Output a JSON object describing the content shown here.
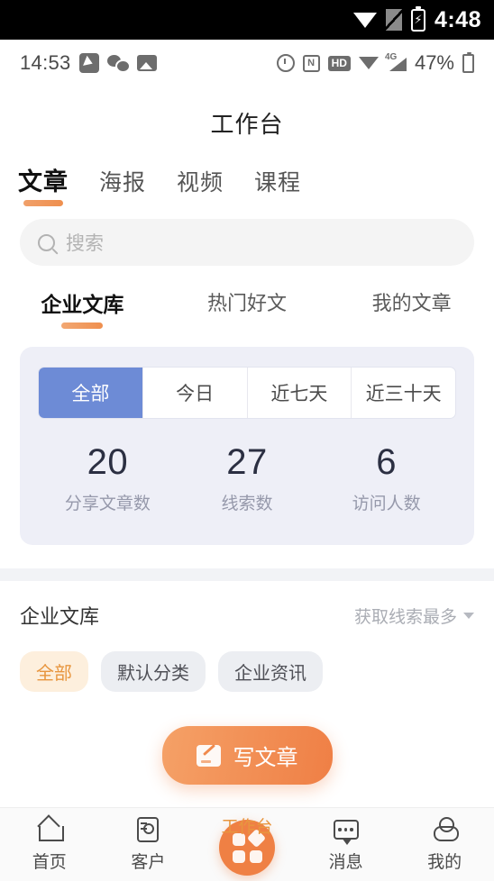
{
  "system_bar": {
    "time": "4:48",
    "icons": [
      "wifi-icon",
      "sim-off-icon",
      "battery-charging-icon"
    ]
  },
  "app_status_bar": {
    "time": "14:53",
    "battery_percent": "47%",
    "network_gen": "4G",
    "hd_label": "HD",
    "nfc_label": "N",
    "left_icons": [
      "navigation-icon",
      "wechat-icon",
      "photo-icon"
    ],
    "right_icons": [
      "alarm-icon",
      "nfc-icon",
      "hd-icon",
      "wifi-icon",
      "signal-icon",
      "battery-icon"
    ]
  },
  "header": {
    "title": "工作台"
  },
  "main_tabs": [
    {
      "label": "文章",
      "active": true
    },
    {
      "label": "海报",
      "active": false
    },
    {
      "label": "视频",
      "active": false
    },
    {
      "label": "课程",
      "active": false
    }
  ],
  "search": {
    "placeholder": "搜索",
    "value": ""
  },
  "sub_tabs": [
    {
      "label": "企业文库",
      "active": true
    },
    {
      "label": "热门好文",
      "active": false
    },
    {
      "label": "我的文章",
      "active": false
    }
  ],
  "stats_card": {
    "segments": [
      {
        "label": "全部",
        "active": true
      },
      {
        "label": "今日",
        "active": false
      },
      {
        "label": "近七天",
        "active": false
      },
      {
        "label": "近三十天",
        "active": false
      }
    ],
    "metrics": [
      {
        "value": "20",
        "label": "分享文章数"
      },
      {
        "value": "27",
        "label": "线索数"
      },
      {
        "value": "6",
        "label": "访问人数"
      }
    ]
  },
  "library": {
    "title": "企业文库",
    "sort_label": "获取线索最多",
    "chips": [
      {
        "label": "全部",
        "active": true
      },
      {
        "label": "默认分类",
        "active": false
      },
      {
        "label": "企业资讯",
        "active": false
      }
    ]
  },
  "fab": {
    "label": "写文章"
  },
  "bottom_nav": [
    {
      "label": "首页",
      "active": false
    },
    {
      "label": "客户",
      "active": false
    },
    {
      "label": "工作台",
      "active": true
    },
    {
      "label": "消息",
      "active": false
    },
    {
      "label": "我的",
      "active": false
    }
  ],
  "colors": {
    "accent": "#ef8044",
    "accent_light": "#fdefdd",
    "segment_active": "#6d8bd6",
    "card_bg": "#eeeff7"
  }
}
